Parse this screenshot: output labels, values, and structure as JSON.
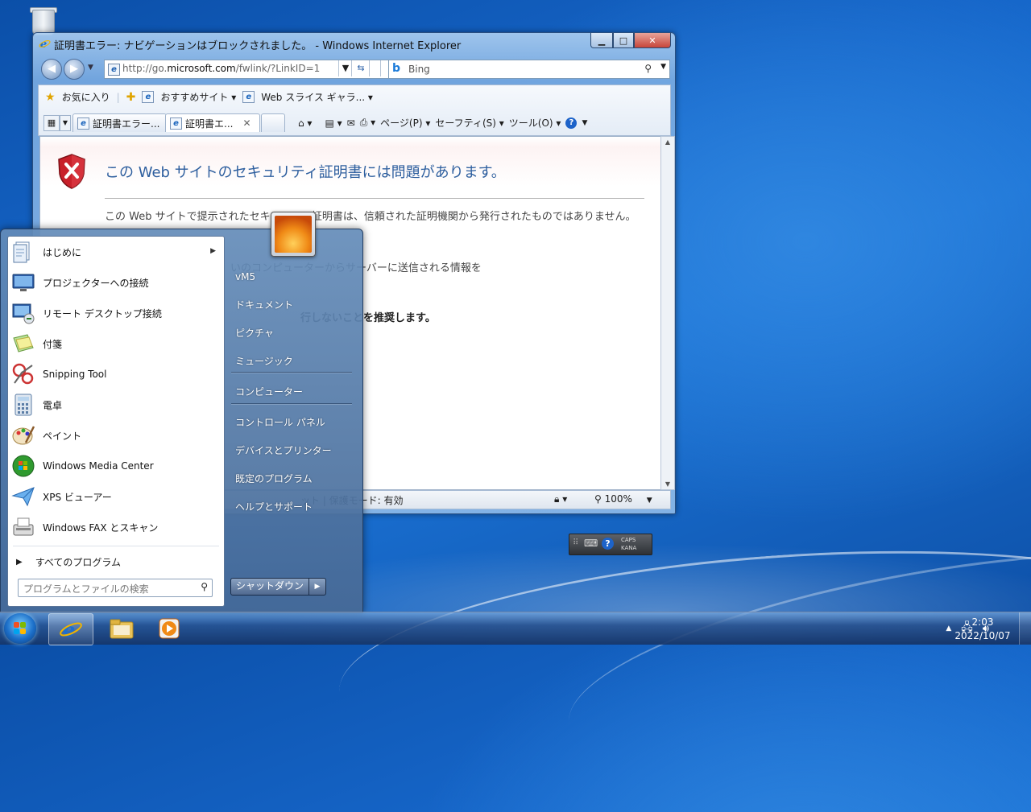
{
  "window": {
    "title": "証明書エラー: ナビゲーションはブロックされました。 - Windows Internet Explorer",
    "address_prefix": "http://go.",
    "address_domain": "microsoft.com",
    "address_suffix": "/fwlink/?LinkID=1",
    "search_provider": "Bing",
    "favorites_label": "お気に入り",
    "suggested_sites": "おすすめサイト",
    "web_slice": "Web スライス ギャラ...",
    "tabs": [
      {
        "label": "証明書エラー..."
      },
      {
        "label": "証明書エ..."
      }
    ],
    "commands": {
      "page": "ページ(P)",
      "safety": "セーフティ(S)",
      "tools": "ツール(O)"
    },
    "content": {
      "heading": "この Web サイトのセキュリティ証明書には問題があります。",
      "para1": "この Web サイトで提示されたセキュリティ証明書は、信頼された証明機関から発行されたものではありません。",
      "para2": "いのコンピューターからサーバーに送信される情報を",
      "para3": "行しないことを推奨します。"
    },
    "status": {
      "protected_mode": "ット | 保護モード: 有効",
      "zoom": "100%"
    },
    "ime": {
      "caps": "CAPS",
      "kana": "KANA"
    }
  },
  "start_menu": {
    "programs": [
      {
        "label": "はじめに",
        "icon": "getting-started-icon",
        "submenu": true
      },
      {
        "label": "プロジェクターへの接続",
        "icon": "projector-icon"
      },
      {
        "label": "リモート デスクトップ接続",
        "icon": "remote-desktop-icon"
      },
      {
        "label": "付箋",
        "icon": "sticky-notes-icon"
      },
      {
        "label": "Snipping Tool",
        "icon": "snipping-tool-icon"
      },
      {
        "label": "電卓",
        "icon": "calculator-icon"
      },
      {
        "label": "ペイント",
        "icon": "paint-icon"
      },
      {
        "label": "Windows Media Center",
        "icon": "media-center-icon"
      },
      {
        "label": "XPS ビューアー",
        "icon": "xps-viewer-icon"
      },
      {
        "label": "Windows FAX とスキャン",
        "icon": "fax-scan-icon"
      }
    ],
    "all_programs": "すべてのプログラム",
    "search_placeholder": "プログラムとファイルの検索",
    "right_links": [
      "vM5",
      "ドキュメント",
      "ピクチャ",
      "ミュージック",
      "コンピューター",
      "コントロール パネル",
      "デバイスとプリンター",
      "既定のプログラム",
      "ヘルプとサポート"
    ],
    "shutdown": "シャットダウン"
  },
  "taskbar": {
    "time": "2:03",
    "date": "2022/10/07"
  }
}
